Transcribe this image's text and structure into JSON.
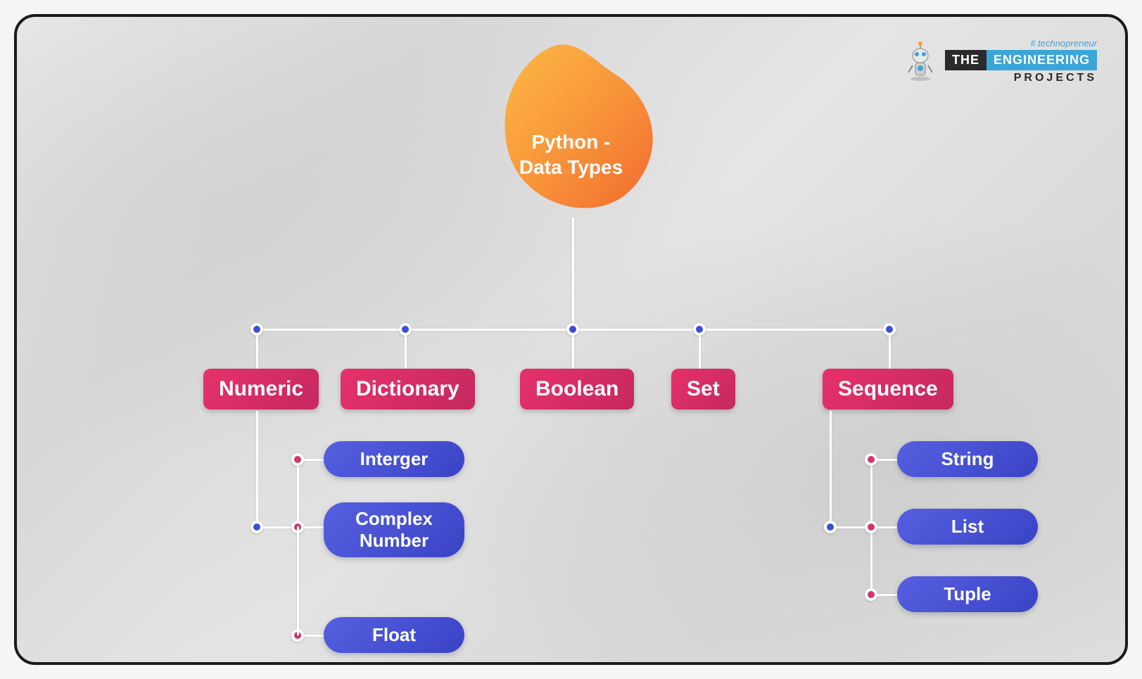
{
  "logo": {
    "tagline": "# technopreneur",
    "word1": "THE",
    "word2": "ENGINEERING",
    "word3": "PROJECTS"
  },
  "root": {
    "line1": "Python -",
    "line2": "Data Types"
  },
  "categories": {
    "numeric": "Numeric",
    "dictionary": "Dictionary",
    "boolean": "Boolean",
    "set": "Set",
    "sequence": "Sequence"
  },
  "numeric_children": {
    "integer": "Interger",
    "complex_l1": "Complex",
    "complex_l2": "Number",
    "float": "Float"
  },
  "sequence_children": {
    "string": "String",
    "list": "List",
    "tuple": "Tuple"
  }
}
